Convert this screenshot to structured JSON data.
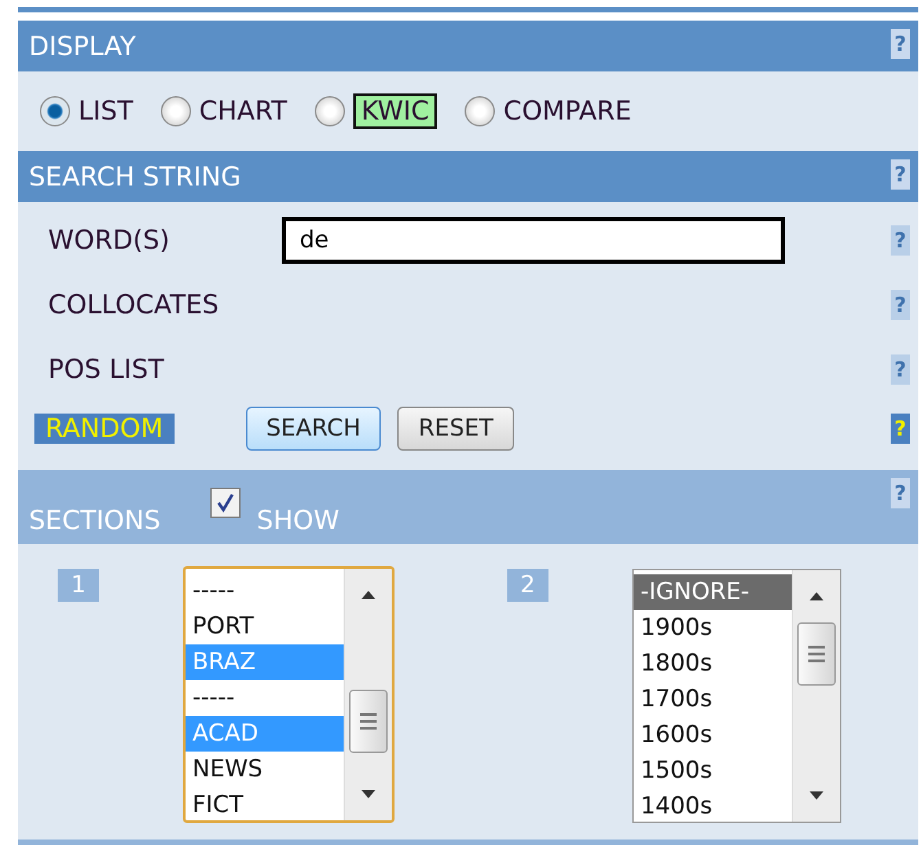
{
  "display": {
    "title": "DISPLAY",
    "help": "?",
    "options": [
      {
        "label": "LIST",
        "selected": true,
        "highlighted": false
      },
      {
        "label": "CHART",
        "selected": false,
        "highlighted": false
      },
      {
        "label": "KWIC",
        "selected": false,
        "highlighted": true
      },
      {
        "label": "COMPARE",
        "selected": false,
        "highlighted": false
      }
    ]
  },
  "search_string": {
    "title": "SEARCH STRING",
    "help": "?",
    "rows": [
      {
        "kind": "input",
        "label": "WORD(S)",
        "value": "de",
        "help": "?"
      },
      {
        "kind": "text",
        "label": "COLLOCATES",
        "help": "?"
      },
      {
        "kind": "text",
        "label": "POS LIST",
        "help": "?"
      },
      {
        "kind": "buttons",
        "label": "RANDOM",
        "buttons": [
          "SEARCH",
          "RESET"
        ],
        "help": "?"
      }
    ]
  },
  "sections": {
    "title": "SECTIONS",
    "help": "?",
    "show": {
      "label": "SHOW",
      "checked": true
    },
    "lists": [
      {
        "number": "1",
        "focused": true,
        "items": [
          {
            "label": "-----",
            "selected": false
          },
          {
            "label": "PORT",
            "selected": false
          },
          {
            "label": "BRAZ",
            "selected": true
          },
          {
            "label": "-----",
            "selected": false
          },
          {
            "label": "ACAD",
            "selected": true
          },
          {
            "label": "NEWS",
            "selected": false
          },
          {
            "label": "FICT",
            "selected": false
          }
        ]
      },
      {
        "number": "2",
        "focused": false,
        "items": [
          {
            "label": "-IGNORE-",
            "selected": true
          },
          {
            "label": "1900s",
            "selected": false
          },
          {
            "label": "1800s",
            "selected": false
          },
          {
            "label": "1700s",
            "selected": false
          },
          {
            "label": "1600s",
            "selected": false
          },
          {
            "label": "1500s",
            "selected": false
          },
          {
            "label": "1400s",
            "selected": false
          }
        ]
      }
    ]
  }
}
